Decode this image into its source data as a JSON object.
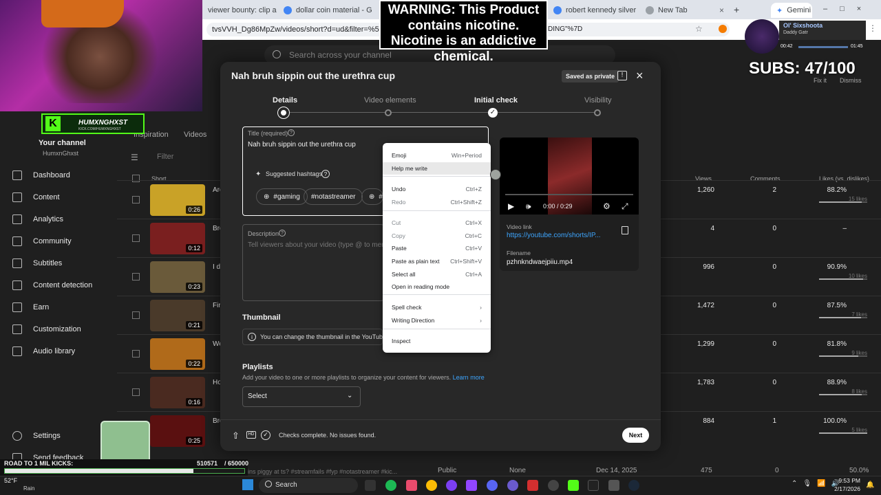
{
  "browser": {
    "tabs": [
      {
        "title": "viewer bounty: clip a 3 "
      },
      {
        "title": "dollar coin material - G"
      },
      {
        "title": "robert kennedy silver co"
      },
      {
        "title": "New Tab"
      }
    ],
    "gemini_tab": "Gemini",
    "url": "tvsVVH_Dg86MpZw/videos/short?d=ud&filter=%5B%5D&sort",
    "url_tail": "DING\"%7D"
  },
  "studio": {
    "search_placeholder": "Search across your channel",
    "your_channel": "Your channel",
    "channel_handle": "HumxnGhxst",
    "tabs": [
      "Inspiration",
      "Videos"
    ],
    "filter_placeholder": "Filter",
    "sidebar": [
      {
        "label": "Dashboard",
        "icon": "dashboard-icon"
      },
      {
        "label": "Content",
        "icon": "content-icon"
      },
      {
        "label": "Analytics",
        "icon": "analytics-icon"
      },
      {
        "label": "Community",
        "icon": "community-icon"
      },
      {
        "label": "Subtitles",
        "icon": "subtitles-icon"
      },
      {
        "label": "Content detection",
        "icon": "content-detection-icon"
      },
      {
        "label": "Earn",
        "icon": "earn-icon"
      },
      {
        "label": "Customization",
        "icon": "customization-icon"
      },
      {
        "label": "Audio library",
        "icon": "audio-library-icon"
      }
    ],
    "settings": "Settings",
    "send_feedback": "Send feedback",
    "list_headers": {
      "short": "Short",
      "views": "Views",
      "comments": "Comments",
      "likes": "Likes (vs. dislikes)"
    },
    "rows": [
      {
        "title": "Are",
        "dur": "0:26",
        "views": "1,260",
        "comments": "2",
        "likes": "88.2%",
        "likes_sub": "15 likes",
        "likes_frac": 0.882
      },
      {
        "title": "Bro",
        "dur": "0:12",
        "views": "4",
        "comments": "0",
        "likes": "–",
        "likes_sub": "",
        "likes_frac": 0
      },
      {
        "title": "I do",
        "dur": "0:23",
        "views": "996",
        "comments": "0",
        "likes": "90.9%",
        "likes_sub": "10 likes",
        "likes_frac": 0.909
      },
      {
        "title": "Fir",
        "dur": "0:21",
        "views": "1,472",
        "comments": "0",
        "likes": "87.5%",
        "likes_sub": "7 likes",
        "likes_frac": 0.875
      },
      {
        "title": "We",
        "dur": "0:22",
        "views": "1,299",
        "comments": "0",
        "likes": "81.8%",
        "likes_sub": "9 likes",
        "likes_frac": 0.818
      },
      {
        "title": "Ho",
        "dur": "0:16",
        "views": "1,783",
        "comments": "0",
        "likes": "88.9%",
        "likes_sub": "8 likes",
        "likes_frac": 0.889
      },
      {
        "title": "Bro",
        "dur": "0:25",
        "views": "884",
        "comments": "1",
        "likes": "100.0%",
        "likes_sub": "5 likes",
        "likes_frac": 1.0
      }
    ],
    "bottom_row": {
      "desc": "Who wanna ins piggy at ts? #streamfails #fyp #notastreamer #kic...",
      "visibility": "Public",
      "restrictions": "None",
      "date": "Dec 14, 2025",
      "views": "475",
      "comments": "0",
      "likes": "50.0%"
    },
    "fix_it": "Fix it",
    "dismiss": "Dismiss"
  },
  "dialog": {
    "title": "Nah bruh sippin out the urethra cup",
    "saved_badge": "Saved as private",
    "steps": [
      "Details",
      "Video elements",
      "Initial check",
      "Visibility"
    ],
    "title_label": "Title (required)",
    "title_value": "Nah bruh sippin out the urethra cup",
    "suggested_hashtags": "Suggested hashtags",
    "hashtags": [
      "#gaming",
      "#notastreamer",
      "#k"
    ],
    "description_label": "Description",
    "description_placeholder": "Tell viewers about your video (type @ to men",
    "thumbnail_heading": "Thumbnail",
    "thumbnail_notice": "You can change the thumbnail in the YouTube mo",
    "playlists_heading": "Playlists",
    "playlists_help": "Add your video to one or more playlists to organize your content for viewers.",
    "learn_more": "Learn more",
    "playlist_select": "Select",
    "video_time": "0:00 / 0:29",
    "video_link_label": "Video link",
    "video_link": "https://youtube.com/shorts/IP...",
    "filename_label": "Filename",
    "filename": "pzhnkndwaejpiiu.mp4",
    "checks_status": "Checks complete. No issues found.",
    "next": "Next",
    "accent": "#3ea6ff"
  },
  "context_menu": {
    "items": [
      {
        "label": "Emoji",
        "key": "Win+Period"
      },
      {
        "label": "Help me write",
        "key": ""
      },
      {
        "label": "Undo",
        "key": "Ctrl+Z"
      },
      {
        "label": "Redo",
        "key": "Ctrl+Shift+Z"
      },
      {
        "label": "Cut",
        "key": "Ctrl+X"
      },
      {
        "label": "Copy",
        "key": "Ctrl+C"
      },
      {
        "label": "Paste",
        "key": "Ctrl+V"
      },
      {
        "label": "Paste as plain text",
        "key": "Ctrl+Shift+V"
      },
      {
        "label": "Select all",
        "key": "Ctrl+A"
      },
      {
        "label": "Open in reading mode",
        "key": ""
      },
      {
        "label": "Spell check",
        "key": "›"
      },
      {
        "label": "Writing Direction",
        "key": "›"
      },
      {
        "label": "Inspect",
        "key": ""
      }
    ]
  },
  "stream_overlay": {
    "warning": "WARNING: This Product contains nicotine. Nicotine is an addictive chemical.",
    "subs": "SUBS: 47/100",
    "kick_name": "HUMXNGHXST",
    "kick_url": "KICK.COM/HUMXNGHXST",
    "road_label": "ROAD TO 1 MIL KICKS:",
    "road_value": "510571",
    "road_target": "/ 650000",
    "road_progress": 0.786,
    "song_title": "Ol' Sixshoota",
    "song_artist": "Daddy Gatr",
    "song_elapsed": "00:42",
    "song_total": "01:45"
  },
  "taskbar": {
    "weather_temp": "52°F",
    "weather_desc": "Rain",
    "search": "Search",
    "time": "9:53 PM",
    "date": "2/17/2026"
  }
}
